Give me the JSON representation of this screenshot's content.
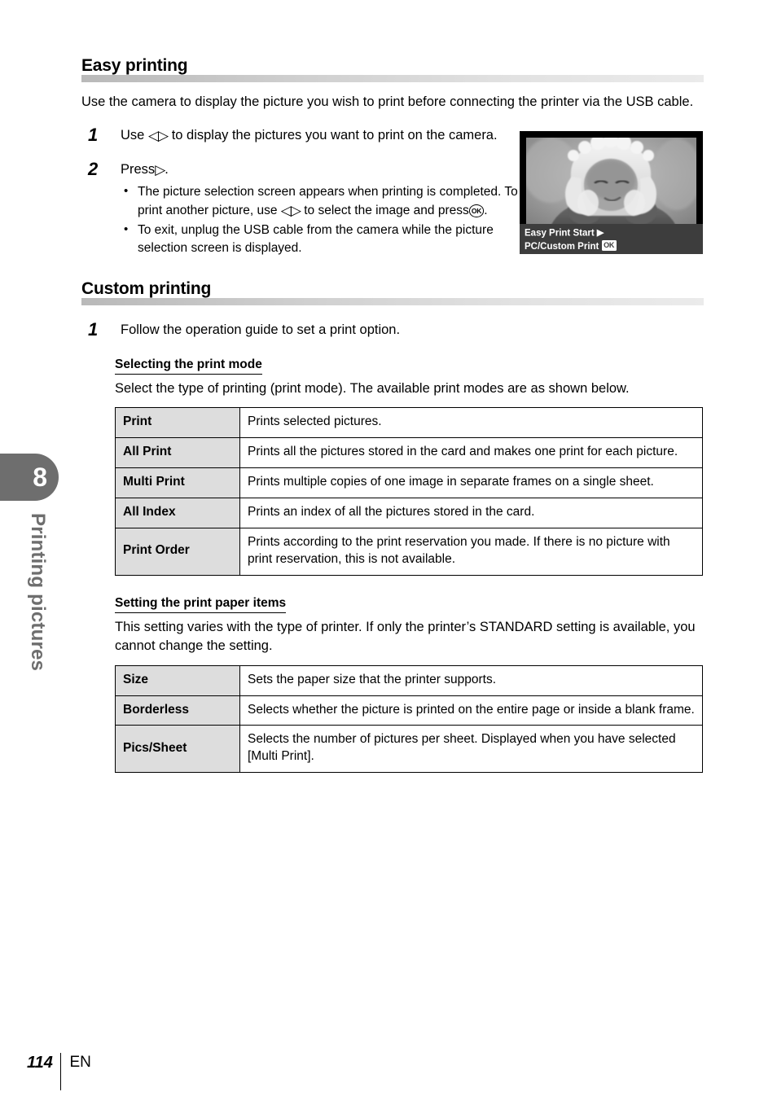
{
  "sidebar": {
    "chapter_number": "8",
    "chapter_label": "Printing pictures"
  },
  "sections": [
    {
      "heading": "Easy printing",
      "intro": "Use the camera to display the picture you wish to print before connecting the printer via the USB cable.",
      "steps": [
        {
          "number": "1",
          "text_before": "Use",
          "glyph": "◁▷",
          "text_after": "to display the pictures you want to print on the camera."
        },
        {
          "number": "2",
          "text_before": "Press",
          "glyph": "▷",
          "text_after": ".",
          "bullets": [
            {
              "part1": "The picture selection screen appears when printing is completed. To print another picture, use",
              "glyph1": "◁▷",
              "part2": "to select the image and press",
              "glyph2": "OK",
              "part3": "."
            },
            {
              "part1": "To exit, unplug the USB cable from the camera while the picture selection screen is displayed."
            }
          ]
        }
      ]
    },
    {
      "heading": "Custom printing",
      "steps": [
        {
          "number": "1",
          "text": "Follow the operation guide to set a print option."
        }
      ]
    }
  ],
  "figure": {
    "name": "camera-monitor-easy-print",
    "osd_line1": "Easy Print Start",
    "osd_line1_glyph": "▶",
    "osd_line2": "PC/Custom Print",
    "osd_line2_badge": "OK"
  },
  "subsections": [
    {
      "title": "Selecting the print mode",
      "body": "Select the type of printing (print mode). The available print modes are as shown below.",
      "table": {
        "rows": [
          {
            "key": "Print",
            "value": "Prints selected pictures."
          },
          {
            "key": "All Print",
            "value": "Prints all the pictures stored in the card and makes one print for each picture."
          },
          {
            "key": "Multi Print",
            "value": "Prints multiple copies of one image in separate frames on a single sheet."
          },
          {
            "key": "All Index",
            "value": "Prints an index of all the pictures stored in the card."
          },
          {
            "key": "Print Order",
            "value": "Prints according to the print reservation you made. If there is no picture with print reservation, this is not available."
          }
        ]
      }
    },
    {
      "title": "Setting the print paper items",
      "body": "This setting varies with the type of printer. If only the printer’s STANDARD setting is available, you cannot change the setting.",
      "table": {
        "rows": [
          {
            "key": "Size",
            "value": "Sets the paper size that the printer supports."
          },
          {
            "key": "Borderless",
            "value": "Selects whether the picture is printed on the entire page or inside a blank frame."
          },
          {
            "key": "Pics/Sheet",
            "value": "Selects the number of pictures per sheet. Displayed when you have selected [Multi Print]."
          }
        ]
      }
    }
  ],
  "footer": {
    "page_number": "114",
    "language": "EN"
  },
  "colors": {
    "chapter_tab": "#6e6e6e",
    "table_key_bg": "#dddddd",
    "osd_bg": "#3d3d3d"
  }
}
